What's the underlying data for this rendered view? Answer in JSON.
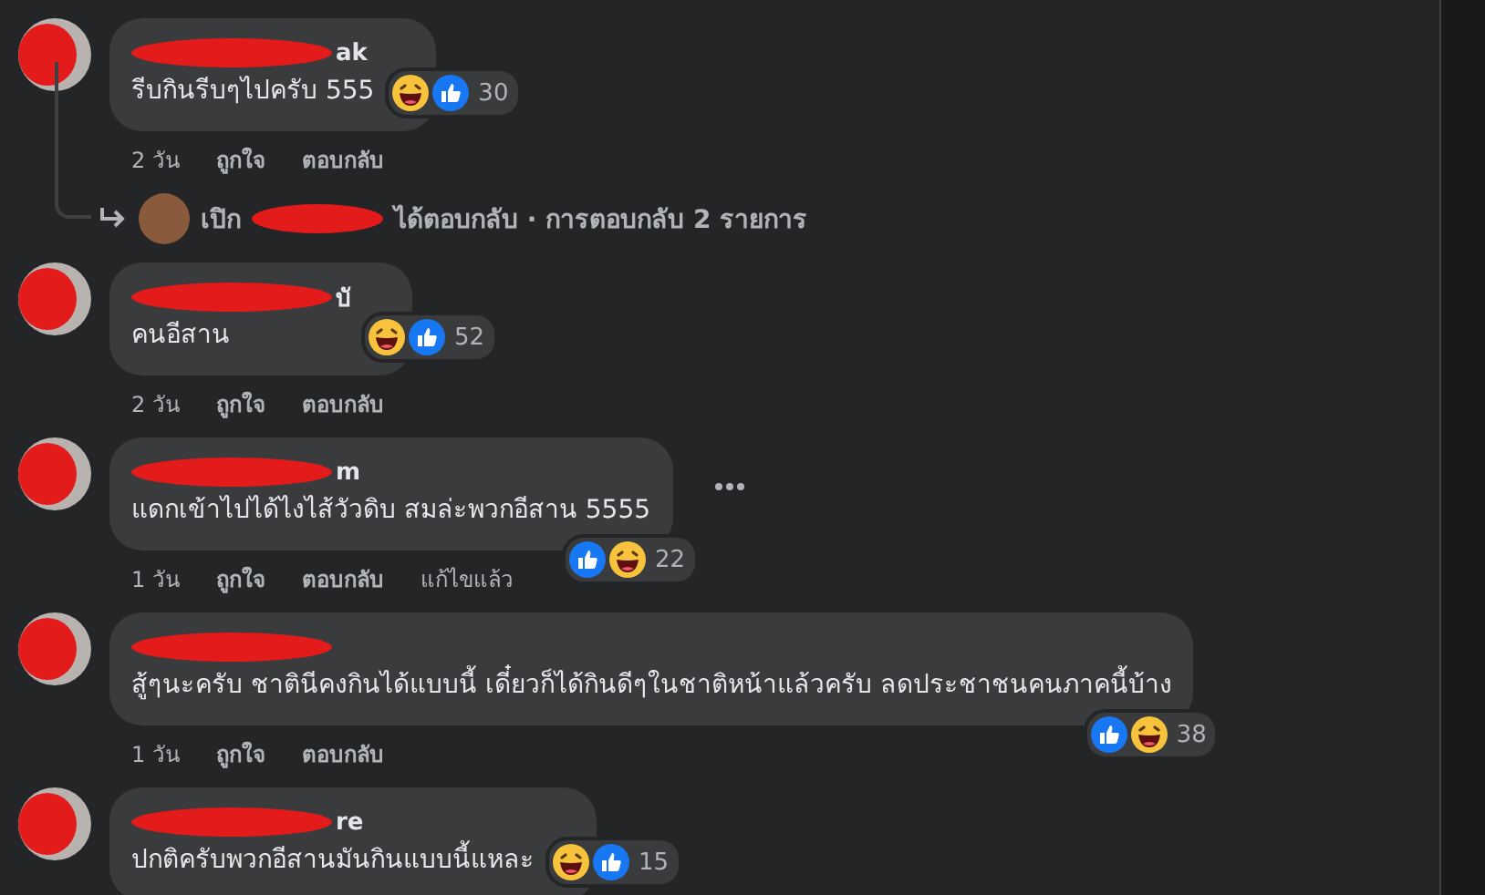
{
  "comments": [
    {
      "name": "ak",
      "text": "รีบกินรีบๆไปครับ 555",
      "reactions": [
        {
          "kind": "haha"
        },
        {
          "kind": "like"
        }
      ],
      "count": "30",
      "time": "2 วัน",
      "actions": [
        "ถูกใจ",
        "ตอบกลับ"
      ],
      "reply": {
        "prefix": "เปิก",
        "suffix": "ได้ตอบกลับ · การตอบกลับ 2 รายการ"
      }
    },
    {
      "name": "บั",
      "text": "คนอีสาน",
      "reactions": [
        {
          "kind": "haha"
        },
        {
          "kind": "like"
        }
      ],
      "count": "52",
      "time": "2 วัน",
      "actions": [
        "ถูกใจ",
        "ตอบกลับ"
      ]
    },
    {
      "name": "m",
      "text": "แดกเข้าไปได้ไงไส้วัวดิบ สมล่ะพวกอีสาน 5555",
      "reactions": [
        {
          "kind": "like"
        },
        {
          "kind": "haha"
        }
      ],
      "count": "22",
      "show_more": true,
      "time": "1 วัน",
      "actions": [
        "ถูกใจ",
        "ตอบกลับ"
      ],
      "edited": "แก้ไขแล้ว"
    },
    {
      "text": "สู้ๆนะครับ ชาตินีคงกินได้แบบนี้ เดี๋ยวก็ได้กินดีๆในชาติหน้าแล้วครับ ลดประชาชนคนภาคนี้บ้าง",
      "reactions": [
        {
          "kind": "like"
        },
        {
          "kind": "haha"
        }
      ],
      "count": "38",
      "time": "1 วัน",
      "actions": [
        "ถูกใจ",
        "ตอบกลับ"
      ]
    },
    {
      "name": "re",
      "text": "ปกติครับพวกอีสานมันกินแบบนี้แหละ",
      "reactions": [
        {
          "kind": "haha"
        },
        {
          "kind": "like"
        }
      ],
      "count": "15"
    }
  ]
}
